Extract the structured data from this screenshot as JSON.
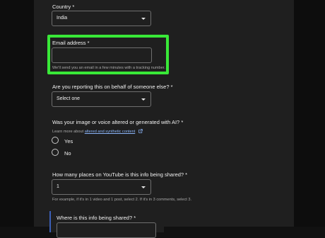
{
  "form": {
    "country": {
      "label": "Country *",
      "value": "India"
    },
    "email": {
      "label": "Email address *",
      "value": "",
      "help": "We'll send you an email in a few minutes with a tracking number."
    },
    "reporting_behalf": {
      "label": "Are you reporting this on behalf of someone else? *",
      "value": "Select one"
    },
    "ai_altered": {
      "label": "Was your image or voice altered or generated with AI? *",
      "learn_prefix": "Learn more about",
      "learn_link": "altered and synthetic content",
      "options": [
        "Yes",
        "No"
      ]
    },
    "places_shared": {
      "label": "How many places on YouTube is this info being shared? *",
      "value": "1",
      "help": "For example, if it's in 1 video and 1 post, select 2. If it's in 3 comments, select 3."
    },
    "where_shared": {
      "label": "Where is this info being shared? *"
    }
  },
  "colors": {
    "highlight": "#39e838",
    "link": "#8ab4f8",
    "accent_bar": "#3b5fb8"
  },
  "icons": {
    "dropdown": "chevron-down-icon",
    "external_link": "external-link-icon"
  }
}
